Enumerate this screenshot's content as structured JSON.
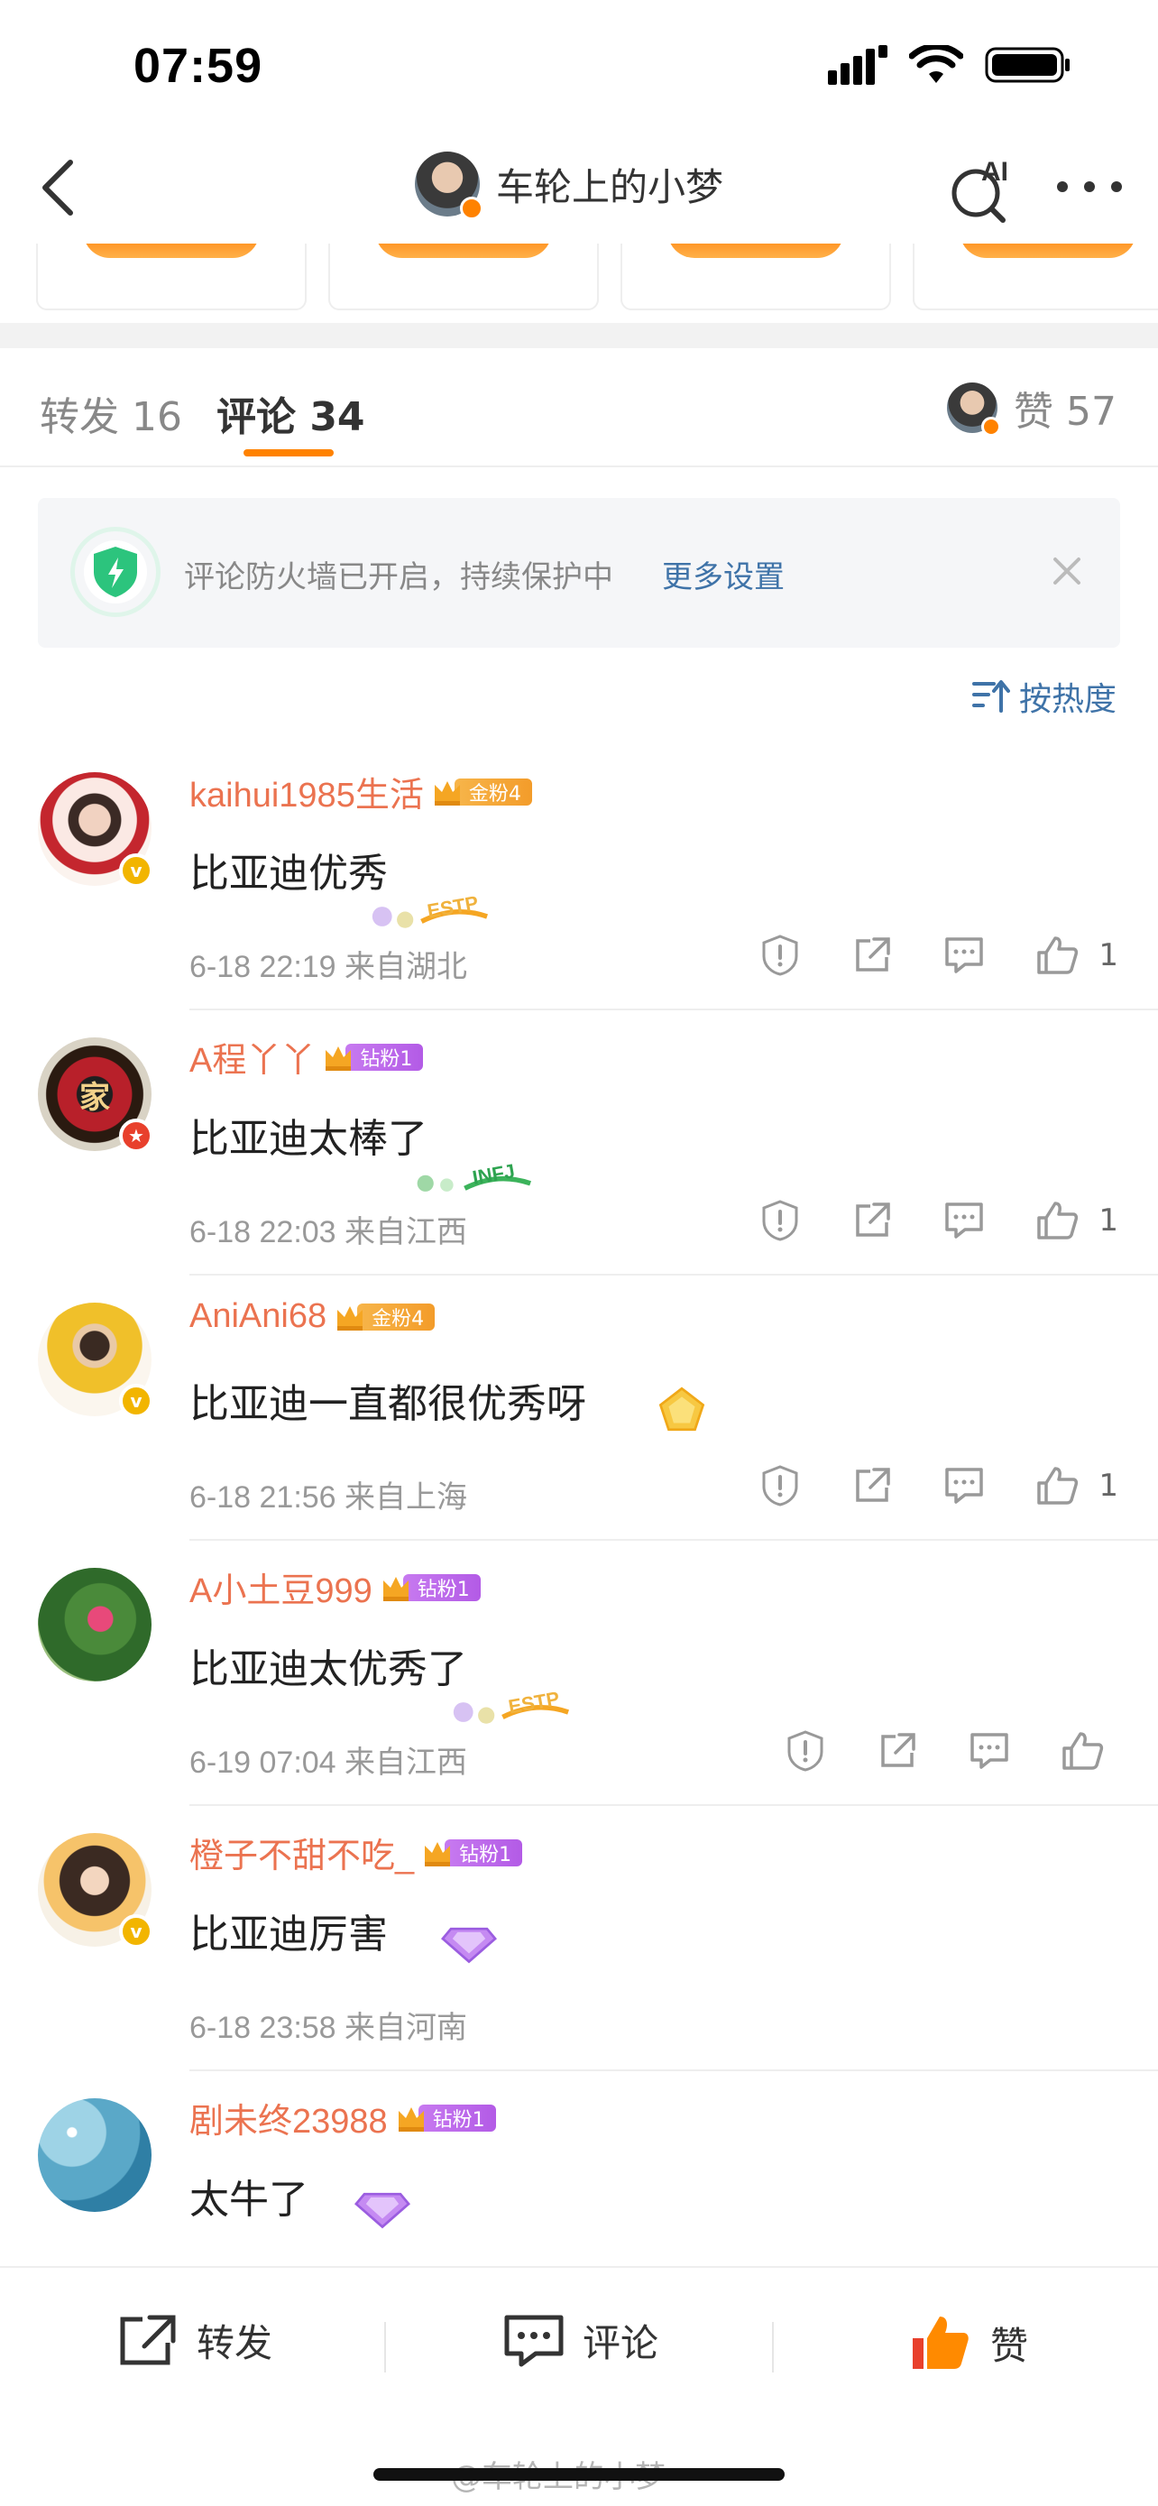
{
  "status_bar": {
    "time": "07:59"
  },
  "nav": {
    "title": "车轮上的小梦",
    "ai_label": "AI"
  },
  "tabs": {
    "repost": "转发 16",
    "comment": "评论 34",
    "like": "赞 57"
  },
  "firewall": {
    "text": "评论防火墙已开启，持续保护中",
    "link": "更多设置"
  },
  "sort": {
    "label": "按热度"
  },
  "comments": [
    {
      "user": "kaihui1985生活",
      "fan_level": "金粉4",
      "text": "比亚迪优秀",
      "meta": "6-18 22:19  来自湖北",
      "likes": "1",
      "sticker_text": "ESTP"
    },
    {
      "user": "A程丫丫",
      "fan_level": "钻粉1",
      "text": "比亚迪太棒了",
      "meta": "6-18 22:03  来自江西",
      "likes": "1",
      "sticker_text": "INFJ"
    },
    {
      "user": "AniAni68",
      "fan_level": "金粉4",
      "text": "比亚迪一直都很优秀呀",
      "meta": "6-18 21:56  来自上海",
      "likes": "1"
    },
    {
      "user": "A小土豆999",
      "fan_level": "钻粉1",
      "text": "比亚迪太优秀了",
      "meta": "6-19 07:04  来自江西",
      "likes": "",
      "sticker_text": "ESTP"
    },
    {
      "user": "橙子不甜不吃_",
      "fan_level": "钻粉1",
      "text": "比亚迪厉害",
      "meta": "6-18 23:58  来自河南",
      "likes": ""
    },
    {
      "user": "剧未终23988",
      "fan_level": "钻粉1",
      "text": "太牛了",
      "meta": "",
      "likes": ""
    }
  ],
  "avatar_decor": {
    "seal_char": "家"
  },
  "bottom_bar": {
    "repost": "转发",
    "comment": "评论",
    "like": "赞"
  },
  "watermark": "@车轮上的小梦",
  "colors": {
    "accent": "#ff8200",
    "username": "#eb7350",
    "link": "#3f73a8"
  }
}
